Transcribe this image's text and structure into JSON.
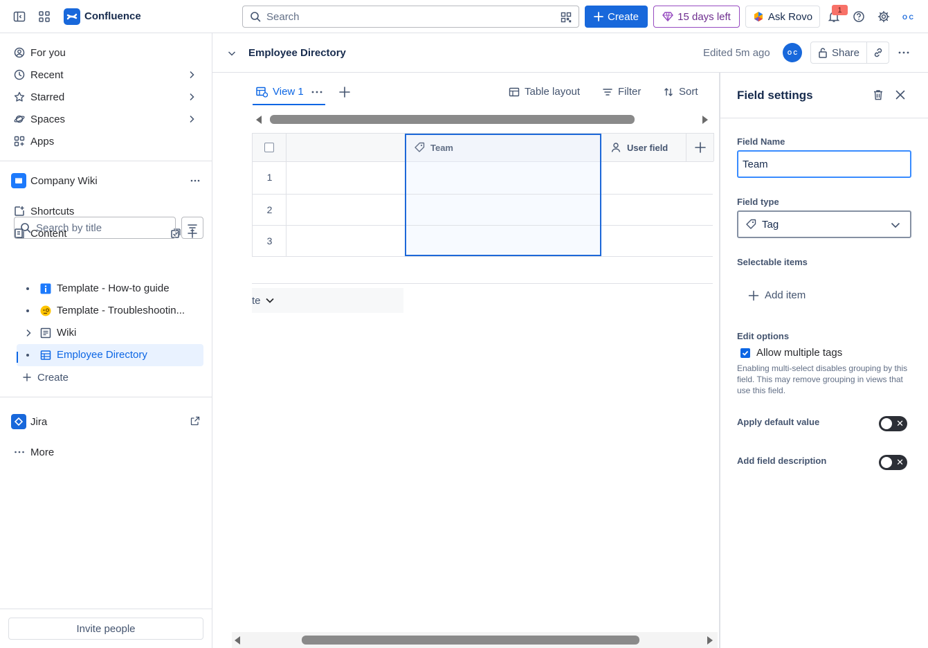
{
  "topbar": {
    "app_name": "Confluence",
    "search_placeholder": "Search",
    "create_label": "Create",
    "trial_label": "15 days left",
    "rovo_label": "Ask Rovo",
    "notification_count": "1",
    "avatar_initials": "O C"
  },
  "sidebar": {
    "nav": [
      {
        "label": "For you"
      },
      {
        "label": "Recent"
      },
      {
        "label": "Starred"
      },
      {
        "label": "Spaces"
      },
      {
        "label": "Apps"
      }
    ],
    "space_name": "Company Wiki",
    "shortcuts_label": "Shortcuts",
    "content_label": "Content",
    "search_placeholder": "Search by title",
    "tree": [
      {
        "label": "Template - How-to guide"
      },
      {
        "label": "Template - Troubleshootin..."
      },
      {
        "label": "Wiki"
      },
      {
        "label": "Employee Directory"
      }
    ],
    "create_label": "Create",
    "jira_label": "Jira",
    "more_label": "More",
    "invite_label": "Invite people"
  },
  "page": {
    "title": "Employee Directory",
    "edited": "Edited 5m ago",
    "avatar_initials": "O C",
    "share_label": "Share"
  },
  "toolbar": {
    "view_label": "View 1",
    "table_layout_label": "Table layout",
    "filter_label": "Filter",
    "sort_label": "Sort"
  },
  "table": {
    "columns": [
      {
        "label": "Team"
      },
      {
        "label": "User field"
      }
    ],
    "rows": [
      "1",
      "2",
      "3"
    ],
    "group_label": "te"
  },
  "panel": {
    "title": "Field settings",
    "field_name_label": "Field Name",
    "field_name_value": "Team",
    "field_type_label": "Field type",
    "field_type_value": "Tag",
    "selectable_items_label": "Selectable items",
    "add_item_label": "Add item",
    "edit_options_label": "Edit options",
    "allow_multiple_label": "Allow multiple tags",
    "allow_multiple_help": "Enabling multi-select disables grouping by this field. This may remove grouping in views that use this field.",
    "default_value_label": "Apply default value",
    "field_description_label": "Add field description"
  },
  "colors": {
    "brand": "#1868db",
    "selection": "#1d68d8",
    "trial": "#964ac0"
  }
}
